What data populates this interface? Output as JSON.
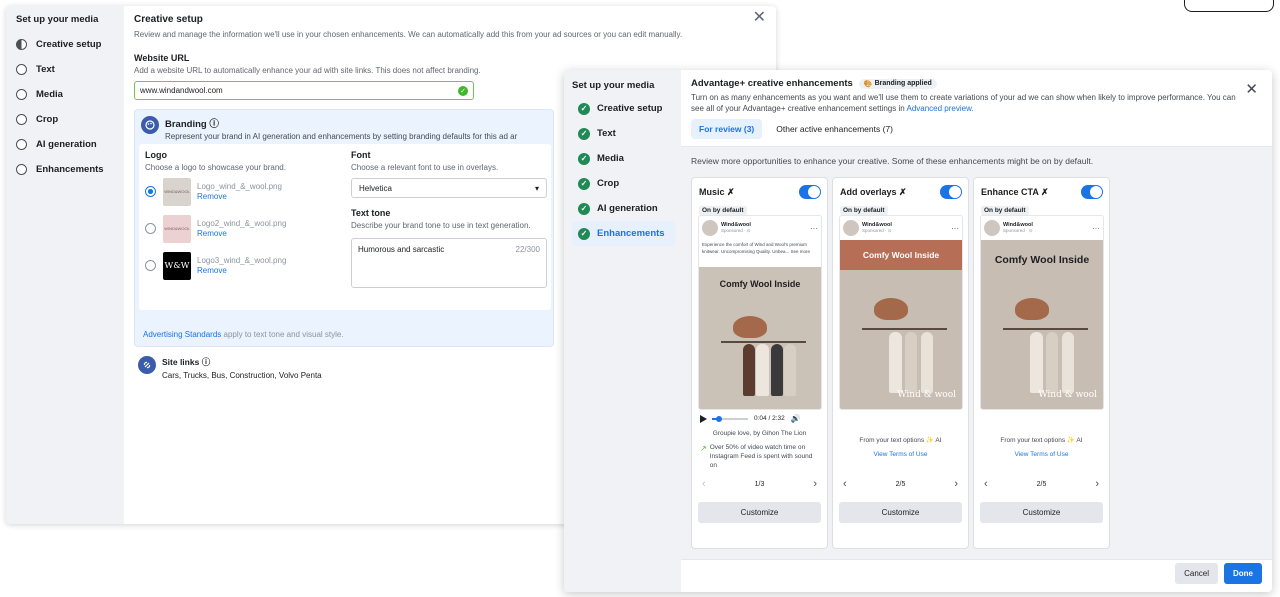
{
  "back": {
    "sidebar": {
      "title": "Set up your media",
      "items": [
        "Creative setup",
        "Text",
        "Media",
        "Crop",
        "AI generation",
        "Enhancements"
      ]
    },
    "title": "Creative setup",
    "description": "Review and manage the information we'll use in your chosen enhancements. We can automatically add this from your ad sources or you can edit manually.",
    "close": "✕",
    "website": {
      "label": "Website URL",
      "sub": "Add a website URL to automatically enhance your ad with site links. This does not affect branding.",
      "value": "www.windandwool.com"
    },
    "branding": {
      "title": "Branding",
      "description": "Represent your brand in AI generation and enhancements by setting branding defaults for this ad ar",
      "logo": {
        "label": "Logo",
        "sub": "Choose a logo to showcase your brand.",
        "items": [
          {
            "file": "Logo_wind_&_wool.png",
            "remove": "Remove",
            "thumb": "WIND&WOOL"
          },
          {
            "file": "Logo2_wind_&_wool.png",
            "remove": "Remove",
            "thumb": "WIND&WOOL"
          },
          {
            "file": "Logo3_wind_&_wool.png",
            "remove": "Remove",
            "thumb": "W&W"
          }
        ]
      },
      "font": {
        "label": "Font",
        "sub": "Choose a relevant font to use in overlays.",
        "value": "Helvetica"
      },
      "tone": {
        "label": "Text tone",
        "sub": "Describe your brand tone to use in text generation.",
        "value": "Humorous and sarcastic",
        "count": "22/300"
      },
      "footer_link": "Advertising Standards",
      "footer_text": " apply to text tone and visual style."
    },
    "site_links": {
      "title": "Site links",
      "value": "Cars, Trucks, Bus, Construction, Volvo Penta"
    }
  },
  "front": {
    "sidebar": {
      "title": "Set up your media",
      "items": [
        "Creative setup",
        "Text",
        "Media",
        "Crop",
        "AI generation",
        "Enhancements"
      ]
    },
    "title": "Advantage+ creative enhancements",
    "badge": "Branding applied",
    "description": "Turn on as many enhancements as you want and we'll use them to create variations of your ad we can show when likely to improve performance. You can see all of your Advantage+ creative enhancement settings in ",
    "description_link": "Advanced preview.",
    "close": "✕",
    "tabs": [
      "For review (3)",
      "Other active enhancements (7)"
    ],
    "intro": "Review more opportunities to enhance your creative. Some of these enhancements might be on by default.",
    "default_badge": "On by default",
    "advertiser": "Wind&wool",
    "sponsored": "Sponsored · ⊙",
    "ad_copy": "Experience the comfort of Wind and Wool's premium knitwear. Uncompromising Quality. Unbea... See more",
    "headline": "Comfy Wool Inside",
    "watermark": "Wind & wool",
    "cards": [
      {
        "title": "Music ✗",
        "page": "1/3",
        "customize": "Customize"
      },
      {
        "title": "Add overlays ✗",
        "page": "2/5",
        "customize": "Customize"
      },
      {
        "title": "Enhance CTA ✗",
        "page": "2/5",
        "customize": "Customize"
      }
    ],
    "music": {
      "time": "0:04 / 2:32",
      "song": "Groupie love, by Gihon The Lion",
      "stat": "Over 50% of video watch time on Instagram Feed is spent with sound on"
    },
    "text_options": "From your text options ✨ AI",
    "terms": "View Terms of Use",
    "cancel": "Cancel",
    "done": "Done"
  },
  "colors": {
    "accent": "#1b74e4",
    "check": "#1f8a54",
    "sidebar_bg": "#f0f2f5",
    "banner": "#b66e56"
  }
}
